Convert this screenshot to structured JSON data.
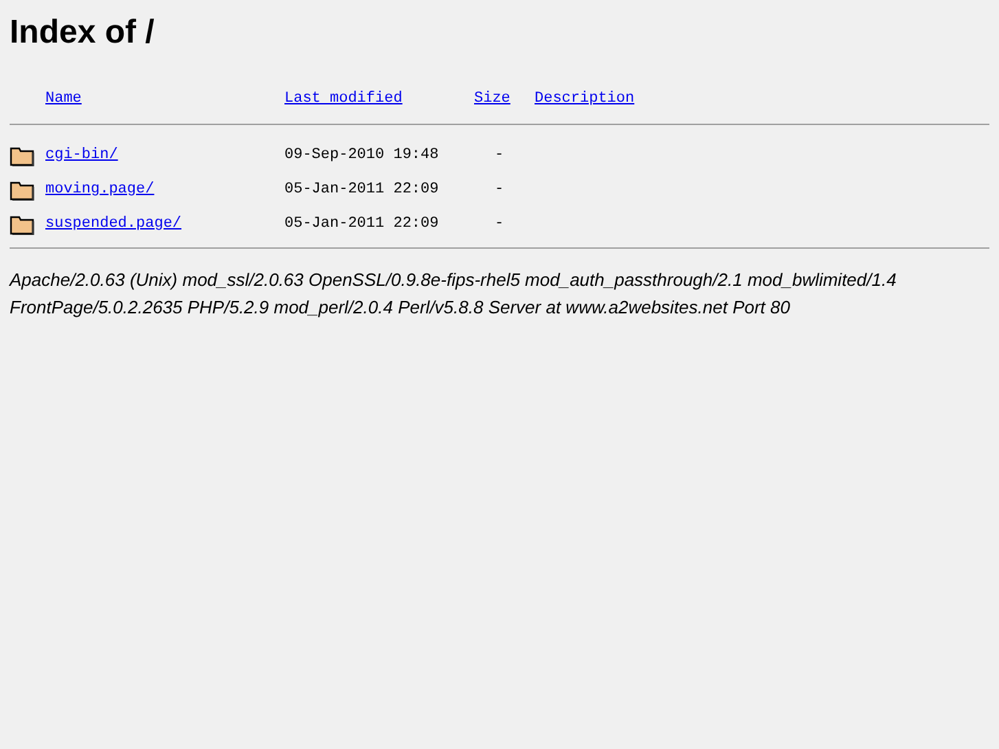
{
  "title": "Index of /",
  "columns": [
    {
      "label": "Name"
    },
    {
      "label": "Last modified"
    },
    {
      "label": "Size"
    },
    {
      "label": "Description"
    }
  ],
  "rows": [
    {
      "name": "cgi-bin/",
      "modified": "09-Sep-2010 19:48",
      "size": "-"
    },
    {
      "name": "moving.page/",
      "modified": "05-Jan-2011 22:09",
      "size": "-"
    },
    {
      "name": "suspended.page/",
      "modified": "05-Jan-2011 22:09",
      "size": "-"
    }
  ],
  "address_lines": [
    "Apache/2.0.63 (Unix) mod_ssl/2.0.63 OpenSSL/0.9.8e-fips-rhel5 mod_auth_passthrough/2.1 mod_bwlimited/1.4",
    "FrontPage/5.0.2.2635 PHP/5.2.9 mod_perl/2.0.4 Perl/v5.8.8 Server at www.a2websites.net Port 80"
  ]
}
